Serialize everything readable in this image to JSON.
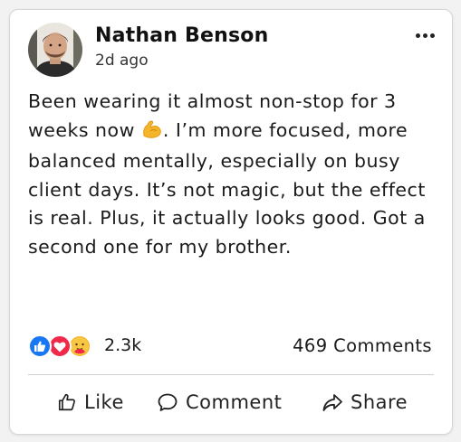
{
  "post": {
    "author": "Nathan Benson",
    "time": "2d ago",
    "text_before_emoji": "Been wearing it almost non-stop for 3 weeks now ",
    "text_after_emoji": ". I’m more focused, more balanced mentally, especially on busy client days. It’s not magic, but the effect is real. Plus, it actually looks good. Got a second one for my brother.",
    "emoji_icon": "flexed-biceps-icon"
  },
  "stats": {
    "reaction_icons": [
      "like-icon",
      "love-icon",
      "care-icon"
    ],
    "reactions_count": "2.3k",
    "comments_count": "469 Comments"
  },
  "actions": {
    "like_label": "Like",
    "comment_label": "Comment",
    "share_label": "Share"
  },
  "colors": {
    "like_blue": "#1877f2",
    "love_red": "#f0284a",
    "care_yellow": "#f7b125"
  }
}
